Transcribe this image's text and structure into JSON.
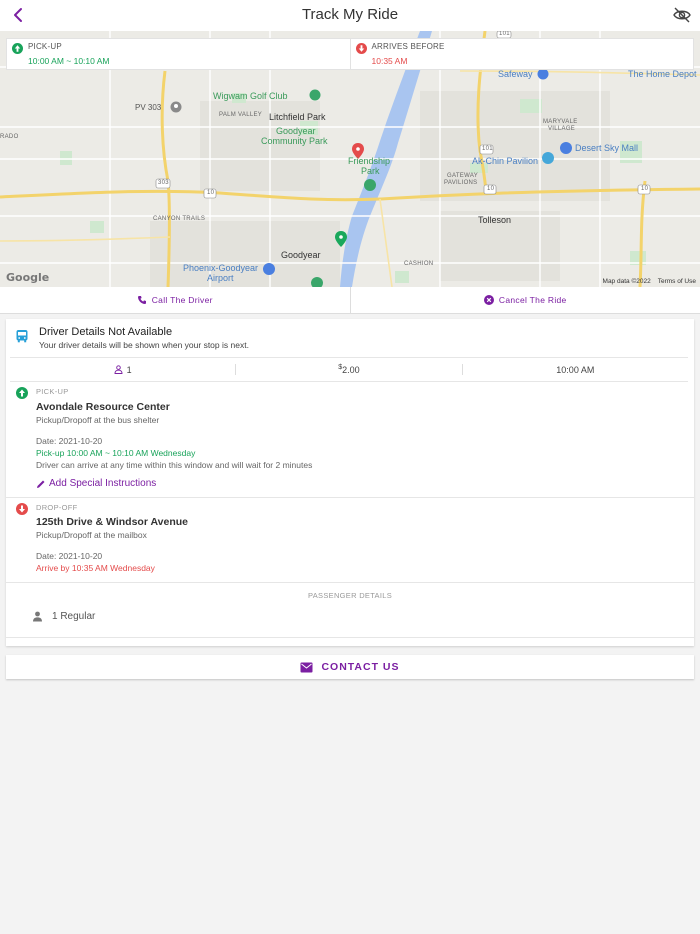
{
  "header": {
    "title": "Track My Ride"
  },
  "map": {
    "pickup_card": {
      "label": "PICK-UP",
      "value": "10:00 AM ~ 10:10 AM"
    },
    "arrival_card": {
      "label": "ARRIVES BEFORE",
      "value": "10:35 AM"
    },
    "labels": {
      "safeway": "Safeway",
      "home_depot": "The Home Depot",
      "wigwam": "Wigwam Golf Club",
      "pv303": "PV 303",
      "palm_valley": "PALM VALLEY",
      "litchfield": "Litchfield Park",
      "goodyear_cp_1": "Goodyear",
      "goodyear_cp_2": "Community Park",
      "maryvale": "MARYVALE",
      "village": "VILLAGE",
      "friendship_1": "Friendship",
      "friendship_2": "Park",
      "akchin": "Ak-Chin Pavilion",
      "desert_sky": "Desert Sky Mall",
      "gateway_1": "GATEWAY",
      "gateway_2": "PAVILIONS",
      "canyon": "CANYON TRAILS",
      "tolleson": "Tolleson",
      "goodyear": "Goodyear",
      "phx_airport_1": "Phoenix-Goodyear",
      "phx_airport_2": "Airport",
      "cashion": "CASHION",
      "rado": "RADO",
      "r303": "303",
      "r101a": "101",
      "r101b": "101",
      "i10a": "10",
      "i10b": "10",
      "i10c": "10"
    },
    "credit_data": "Map data ©2022",
    "credit_terms": "Terms of Use",
    "google": "Google"
  },
  "actions": {
    "call": "Call The Driver",
    "cancel": "Cancel The Ride"
  },
  "driver": {
    "title": "Driver Details Not Available",
    "subtitle": "Your driver details will be shown when your stop is next."
  },
  "stats": {
    "passengers": "1",
    "fare": "2.00",
    "fare_symbol": "$",
    "time": "10:00 AM"
  },
  "pickup": {
    "type": "PICK-UP",
    "name": "Avondale Resource Center",
    "note": "Pickup/Dropoff at the bus shelter",
    "date": "Date: 2021-10-20",
    "window": "Pick-up 10:00 AM ~ 10:10 AM Wednesday",
    "wait_note": "Driver can arrive at any time within this window and will wait for 2 minutes",
    "add_instructions": "Add Special Instructions"
  },
  "dropoff": {
    "type": "DROP-OFF",
    "name": "125th Drive & Windsor Avenue",
    "note": "Pickup/Dropoff at the mailbox",
    "date": "Date: 2021-10-20",
    "arrive": "Arrive by 10:35 AM Wednesday"
  },
  "passenger_details": {
    "title": "PASSENGER DETAILS",
    "regular": "1 Regular"
  },
  "contact": {
    "label": "CONTACT US"
  },
  "colors": {
    "accent": "#7b1fa2",
    "green": "#18a35a",
    "red": "#e44b4b"
  }
}
